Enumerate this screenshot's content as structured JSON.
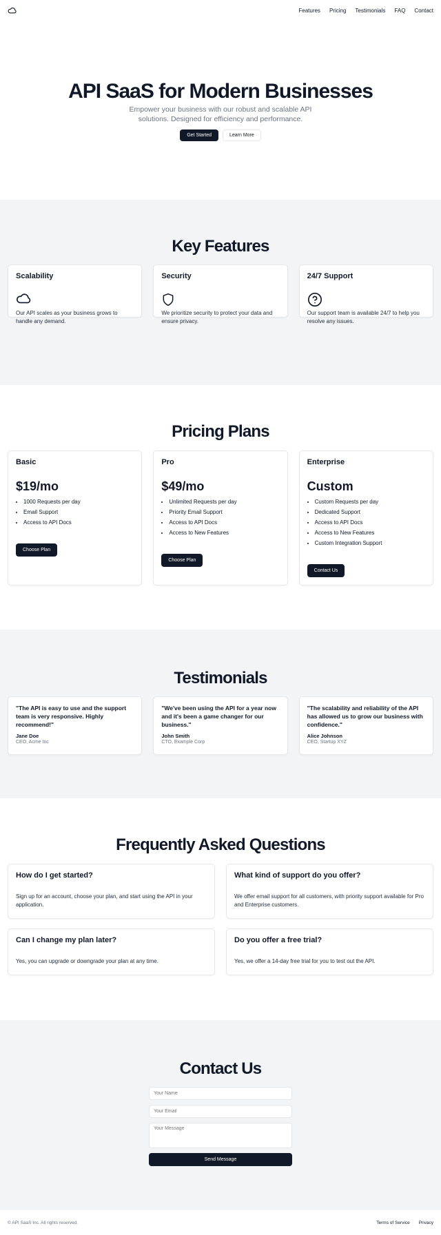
{
  "header": {
    "logo_icon": "cloud-icon",
    "nav": [
      "Features",
      "Pricing",
      "Testimonials",
      "FAQ",
      "Contact"
    ]
  },
  "hero": {
    "title": "API SaaS for Modern Businesses",
    "subtitle": "Empower your business with our robust and scalable API solutions. Designed for efficiency and performance.",
    "primary_cta": "Get Started",
    "secondary_cta": "Learn More"
  },
  "features": {
    "title": "Key Features",
    "items": [
      {
        "title": "Scalability",
        "icon": "cloud-icon",
        "description": "Our API scales as your business grows to handle any demand."
      },
      {
        "title": "Security",
        "icon": "shield-icon",
        "description": "We prioritize security to protect your data and ensure privacy."
      },
      {
        "title": "24/7 Support",
        "icon": "help-circle-icon",
        "description": "Our support team is available 24/7 to help you resolve any issues."
      }
    ]
  },
  "pricing": {
    "title": "Pricing Plans",
    "plans": [
      {
        "name": "Basic",
        "price": "$19/mo",
        "features": [
          "1000 Requests per day",
          "Email Support",
          "Access to API Docs"
        ],
        "cta": "Choose Plan"
      },
      {
        "name": "Pro",
        "price": "$49/mo",
        "features": [
          "Unlimited Requests per day",
          "Priority Email Support",
          "Access to API Docs",
          "Access to New Features"
        ],
        "cta": "Choose Plan"
      },
      {
        "name": "Enterprise",
        "price": "Custom",
        "features": [
          "Custom Requests per day",
          "Dedicated Support",
          "Access to API Docs",
          "Access to New Features",
          "Custom Integration Support"
        ],
        "cta": "Contact Us"
      }
    ]
  },
  "testimonials": {
    "title": "Testimonials",
    "items": [
      {
        "quote": "\"The API is easy to use and the support team is very responsive. Highly recommend!\"",
        "name": "Jane Doe",
        "role": "CEO, Acme Inc"
      },
      {
        "quote": "\"We've been using the API for a year now and it's been a game changer for our business.\"",
        "name": "John Smith",
        "role": "CTO, Example Corp"
      },
      {
        "quote": "\"The scalability and reliability of the API has allowed us to grow our business with confidence.\"",
        "name": "Alice Johnson",
        "role": "CEO, Startup XYZ"
      }
    ]
  },
  "faq": {
    "title": "Frequently Asked Questions",
    "items": [
      {
        "question": "How do I get started?",
        "answer": "Sign up for an account, choose your plan, and start using the API in your application."
      },
      {
        "question": "What kind of support do you offer?",
        "answer": "We offer email support for all customers, with priority support available for Pro and Enterprise customers."
      },
      {
        "question": "Can I change my plan later?",
        "answer": "Yes, you can upgrade or downgrade your plan at any time."
      },
      {
        "question": "Do you offer a free trial?",
        "answer": "Yes, we offer a 14-day free trial for you to test out the API."
      }
    ]
  },
  "contact": {
    "title": "Contact Us",
    "name_placeholder": "Your Name",
    "email_placeholder": "Your Email",
    "message_placeholder": "Your Message",
    "submit": "Send Message"
  },
  "footer": {
    "copyright": "© API SaaS Inc. All rights reserved.",
    "links": [
      "Terms of Service",
      "Privacy"
    ]
  }
}
